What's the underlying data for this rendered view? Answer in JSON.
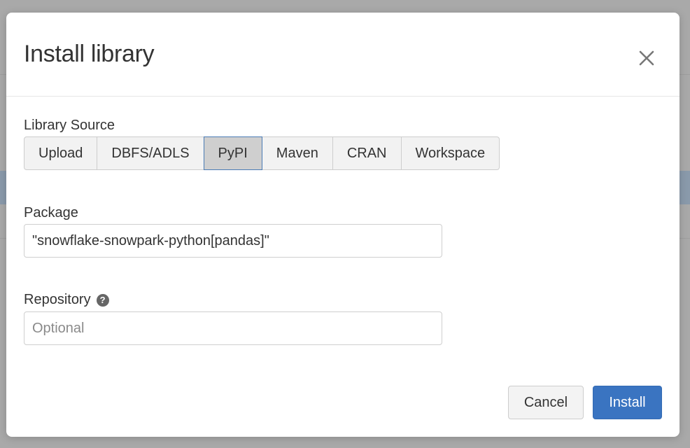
{
  "dialog": {
    "title": "Install library",
    "close_icon": "close-icon"
  },
  "library_source": {
    "label": "Library Source",
    "options": [
      "Upload",
      "DBFS/ADLS",
      "PyPI",
      "Maven",
      "CRAN",
      "Workspace"
    ],
    "selected": "PyPI"
  },
  "package": {
    "label": "Package",
    "value": "\"snowflake-snowpark-python[pandas]\""
  },
  "repository": {
    "label": "Repository",
    "help_icon": "help-icon",
    "help_glyph": "?",
    "placeholder": "Optional",
    "value": ""
  },
  "actions": {
    "cancel_label": "Cancel",
    "install_label": "Install"
  },
  "colors": {
    "primary": "#3a74c1",
    "selected_border": "#4a7bb5",
    "overlay": "#a9a9a9"
  }
}
